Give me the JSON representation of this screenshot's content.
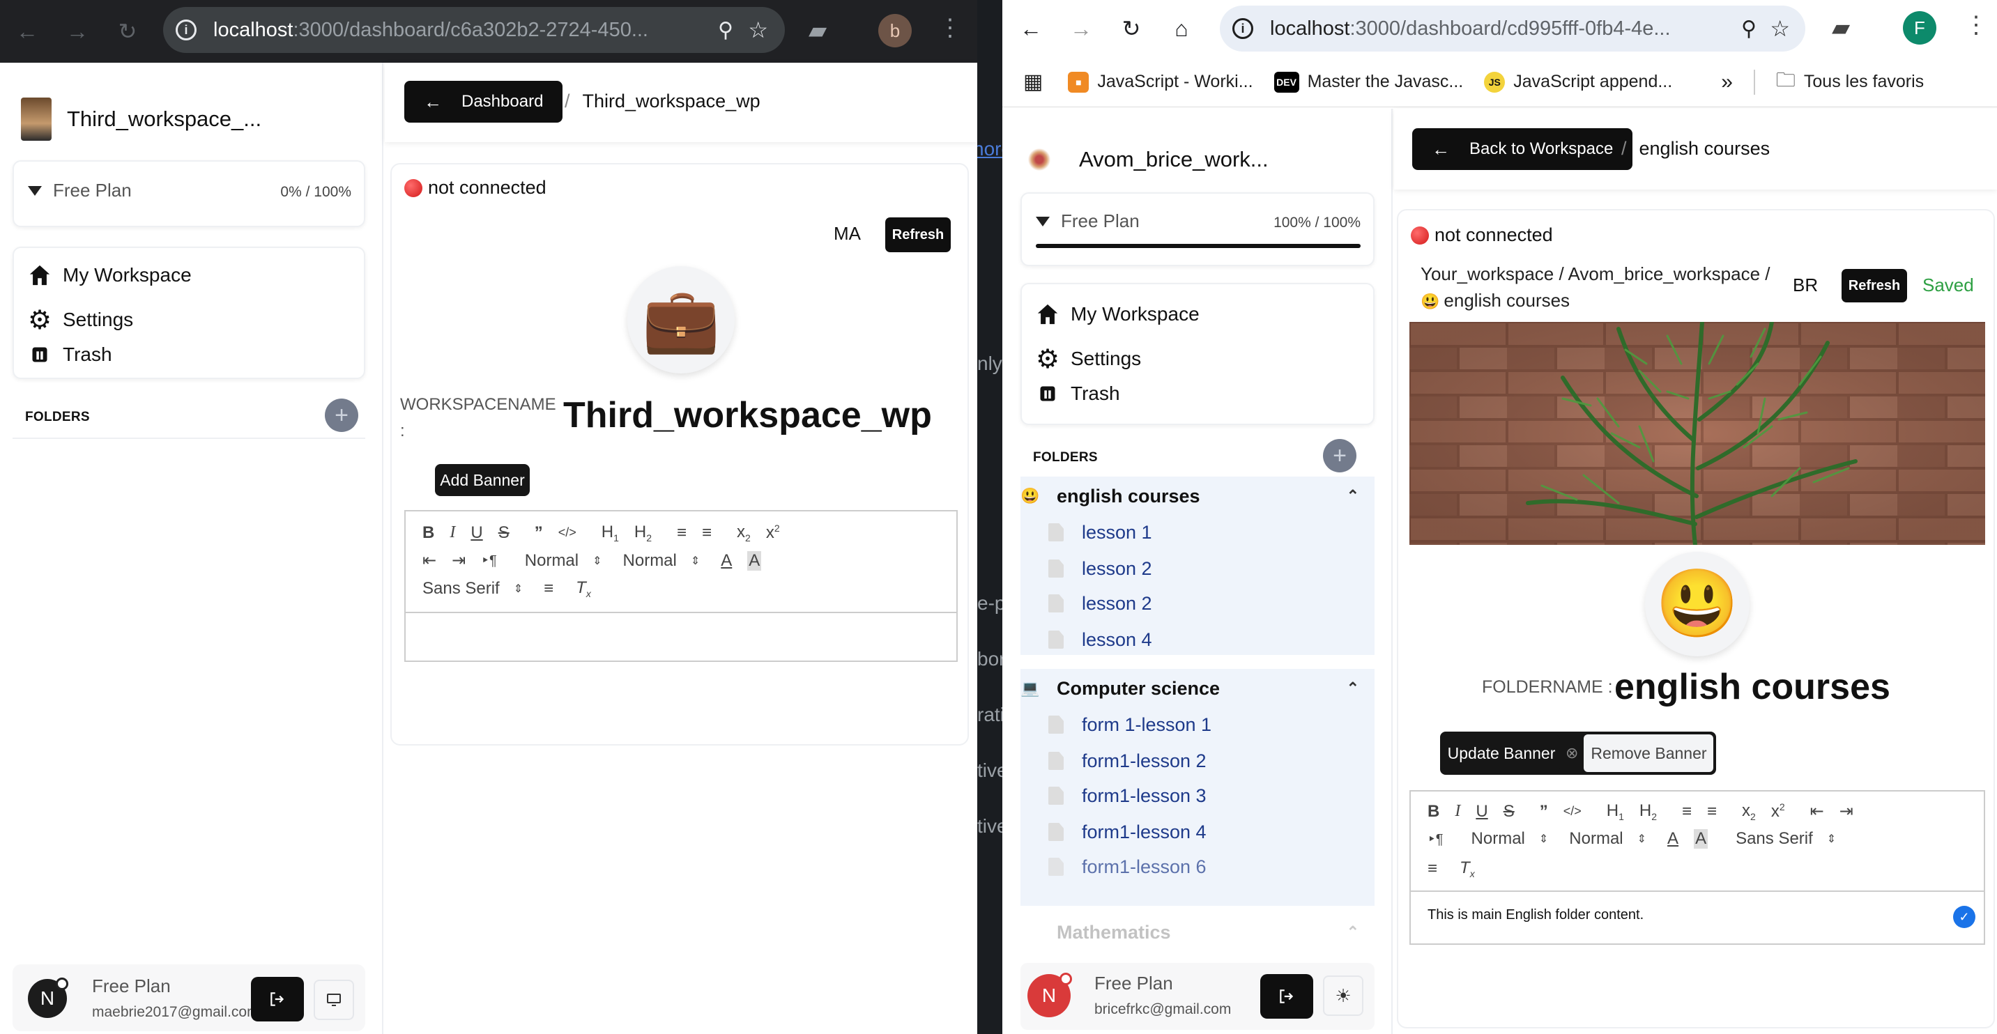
{
  "left": {
    "url": {
      "host": "localhost",
      "path": ":3000/dashboard/c6a302b2-2724-450..."
    },
    "profile_letter": "b",
    "workspace_name": "Third_workspace_...",
    "plan": {
      "label": "Free Plan",
      "usage": "0% / 100%",
      "progress": 0
    },
    "menu": {
      "home": "My Workspace",
      "settings": "Settings",
      "trash": "Trash"
    },
    "folders_label": "FOLDERS",
    "footer": {
      "avatar": "N",
      "plan": "Free Plan",
      "email": "maebrie2017@gmail.com"
    },
    "back_label": "Dashboard",
    "crumb": "Third_workspace_wp",
    "status": "not connected",
    "user_badge": "MA",
    "refresh": "Refresh",
    "icon_emoji": "💼",
    "name_label": "WORKSPACENAME",
    "name_colon": ":",
    "title": "Third_workspace_wp",
    "add_banner": "Add Banner",
    "toolbar": {
      "heading": "Normal",
      "size": "Normal",
      "font": "Sans Serif"
    }
  },
  "right": {
    "url": {
      "host": "localhost",
      "path": ":3000/dashboard/cd995fff-0fb4-4e..."
    },
    "profile_letter": "F",
    "bookmarks": [
      "JavaScript - Worki...",
      "Master the Javasc...",
      "JavaScript append...",
      "Tous les favoris"
    ],
    "bookmark_badges": [
      "DEV",
      "JS"
    ],
    "workspace_name": "Avom_brice_work...",
    "plan": {
      "label": "Free Plan",
      "usage": "100% / 100%",
      "progress": 1
    },
    "menu": {
      "home": "My Workspace",
      "settings": "Settings",
      "trash": "Trash"
    },
    "folders_label": "FOLDERS",
    "folders": [
      {
        "emoji": "😃",
        "name": "english courses",
        "files": [
          "lesson 1",
          "lesson 2",
          "lesson 2",
          "lesson 4"
        ]
      },
      {
        "emoji": "💻",
        "name": "Computer science",
        "files": [
          "form 1-lesson 1",
          "form1-lesson 2",
          "form1-lesson 3",
          "form1-lesson 4",
          "form1-lesson 6"
        ]
      },
      {
        "emoji": "",
        "name": "Mathematics",
        "files": []
      }
    ],
    "footer": {
      "avatar": "N",
      "plan": "Free Plan",
      "email": "bricefrkc@gmail.com"
    },
    "back_label": "Back to Workspace",
    "crumb": "english courses",
    "status": "not connected",
    "path_line1": "Your_workspace / Avom_brice_workspace /",
    "path_line2": "english courses",
    "path_emoji": "😃",
    "user_badge": "BR",
    "refresh": "Refresh",
    "saved": "Saved",
    "icon_emoji": "😃",
    "name_label": "FOLDERNAME :",
    "title": "english courses",
    "update_banner": "Update Banner",
    "remove_banner": "Remove Banner",
    "toolbar": {
      "heading": "Normal",
      "size": "Normal",
      "font": "Sans Serif"
    },
    "editor_text": "This is main English folder content."
  },
  "gap_fragments": [
    "nore",
    "nly",
    "e-p",
    "bor",
    "rati",
    "tive",
    "tive"
  ]
}
